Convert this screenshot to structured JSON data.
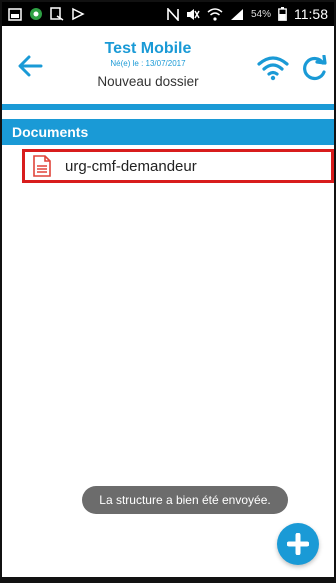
{
  "status_bar": {
    "battery_percent": "54%",
    "time": "11:58",
    "icons": [
      "gallery-icon",
      "record-icon",
      "screen-icon",
      "forward-icon",
      "nfc-icon",
      "mute-icon",
      "wifi-icon",
      "signal-icon",
      "battery-icon"
    ]
  },
  "header": {
    "title": "Test Mobile",
    "subtitle": "Né(e) le : 13/07/2017",
    "folder": "Nouveau dossier",
    "accent_color": "#1a9ad6"
  },
  "documents": {
    "section_label": "Documents",
    "items": [
      {
        "label": "urg-cmf-demandeur",
        "icon": "pdf-document-icon",
        "highlight_color": "#d81c1c"
      }
    ]
  },
  "toast": {
    "message": "La structure a bien été envoyée."
  },
  "fab": {
    "icon": "plus-icon"
  }
}
